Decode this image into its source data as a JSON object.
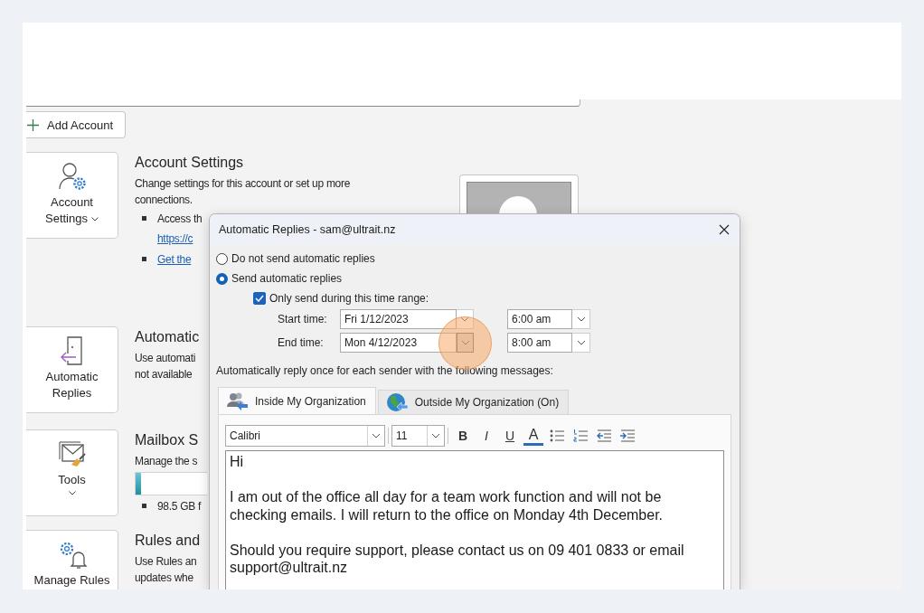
{
  "account_bar": {
    "add_account": "Add Account"
  },
  "sections": [
    {
      "kind": "account",
      "tile": "Account Settings",
      "menu": true,
      "heading": "Account Settings",
      "lines": [
        "Change settings for this account or set up more connections."
      ],
      "bullets": [
        {
          "text": "Access th",
          "link": "https://c"
        },
        {
          "link": "Get the"
        }
      ]
    },
    {
      "kind": "auto_replies",
      "tile": "Automatic Replies",
      "menu": false,
      "heading": "Automatic",
      "lines": [
        "Use automati",
        "not available"
      ]
    },
    {
      "kind": "tools",
      "tile": "Tools",
      "menu": true,
      "heading": "Mailbox S",
      "lines": [
        "Manage the s"
      ],
      "storage": {
        "level": 0.08
      },
      "bullets": [
        {
          "text": "98.5 GB f"
        }
      ]
    },
    {
      "kind": "rules",
      "tile": "Manage Rules",
      "heading": "Rules and",
      "lines": [
        "Use Rules an",
        "updates whe"
      ]
    }
  ],
  "dialog": {
    "title": "Automatic Replies - sam@ultrait.nz",
    "options": [
      {
        "label": "Do not send automatic replies",
        "selected": false
      },
      {
        "label": "Send automatic replies",
        "selected": true
      }
    ],
    "time_range": {
      "label": "Only send during this time range:",
      "checked": true,
      "rows": [
        {
          "label": "Start time:",
          "date": "Fri 1/12/2023",
          "time": "6:00 am",
          "clicked": false
        },
        {
          "label": "End time:",
          "date": "Mon 4/12/2023",
          "time": "8:00 am",
          "clicked": true
        }
      ]
    },
    "instruction": "Automatically reply once for each sender with the following messages:",
    "tabs": [
      {
        "label": "Inside My Organization",
        "selected": true,
        "kind": "inside"
      },
      {
        "label": "Outside My Organization (On)",
        "selected": false,
        "kind": "outside"
      }
    ],
    "editor": {
      "font": "Calibri",
      "size": "11",
      "tools": [
        {
          "kind": "bold",
          "label": "B"
        },
        {
          "kind": "italic",
          "label": "I"
        },
        {
          "kind": "underline",
          "label": "U"
        },
        {
          "kind": "font_color",
          "label": "A"
        },
        {
          "kind": "bullets"
        },
        {
          "kind": "numbering"
        },
        {
          "kind": "outdent"
        },
        {
          "kind": "indent"
        }
      ],
      "body": [
        "Hi",
        "I am out of the office all day for a team work function and will not be checking emails. I will return to the office on Monday 4th December.",
        "Should you require support, please contact us on 09 401 0833 or email support@ultrait.nz"
      ]
    }
  }
}
